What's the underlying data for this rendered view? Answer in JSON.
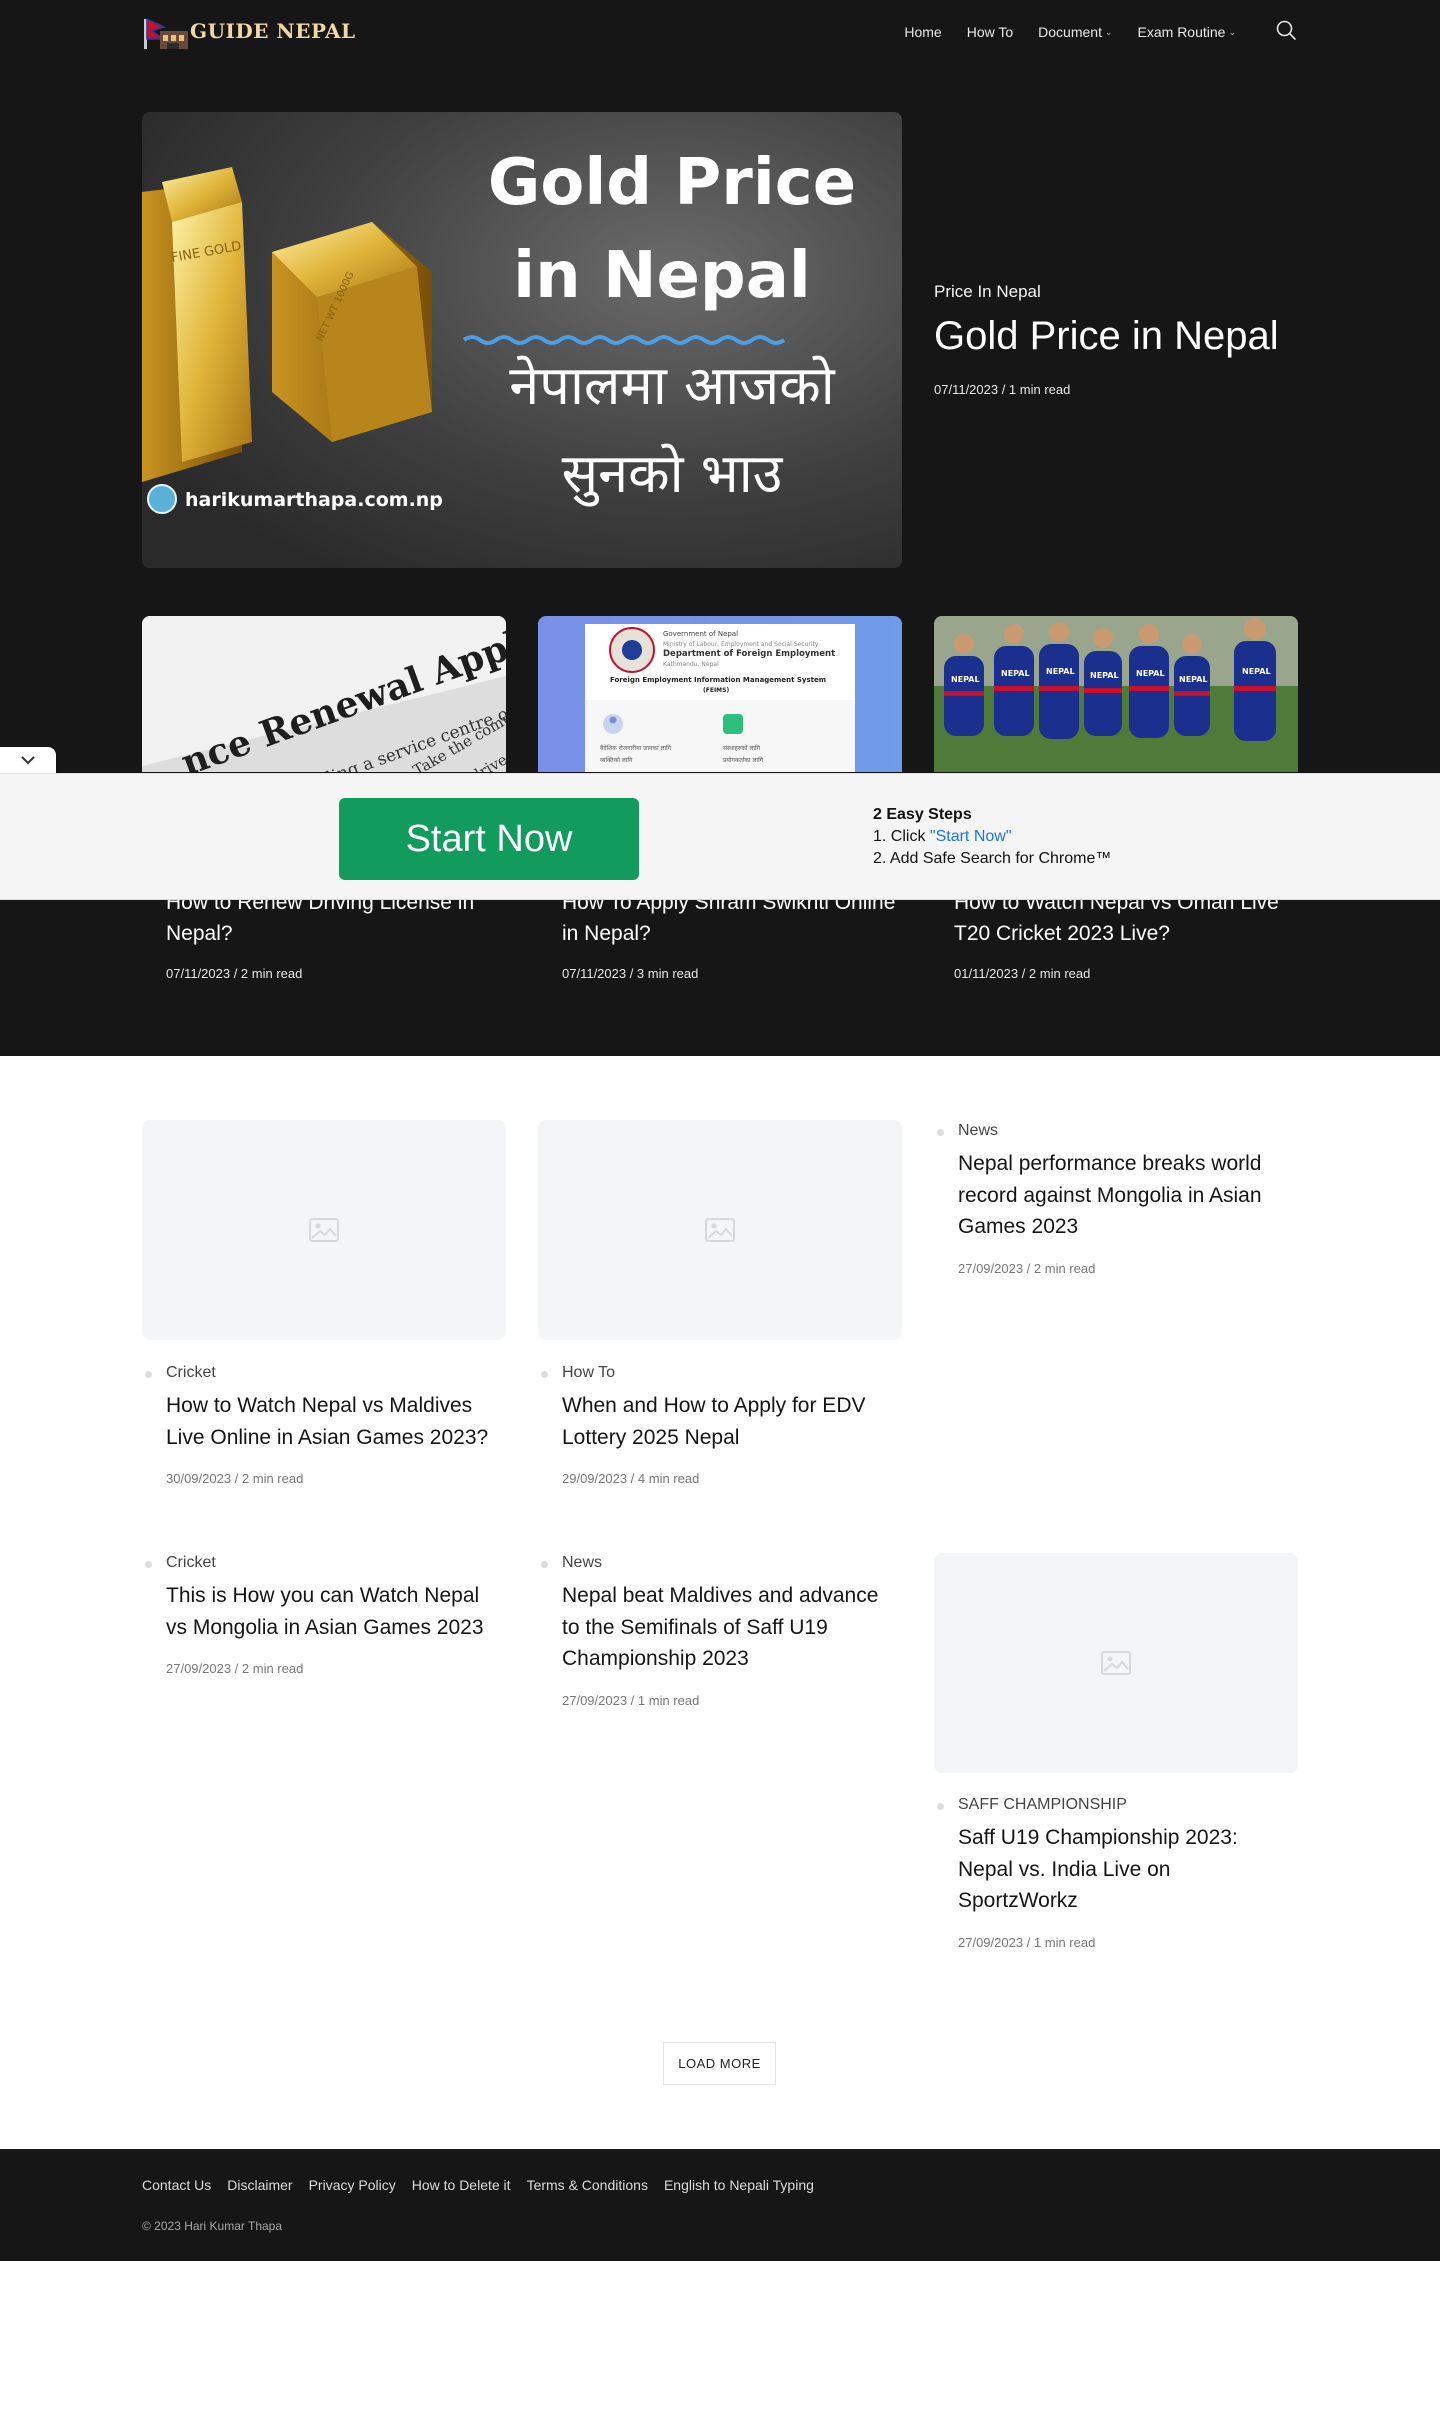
{
  "site": {
    "logo_text": "GUIDE NEPAL"
  },
  "nav": {
    "items": [
      {
        "label": "Home"
      },
      {
        "label": "How To"
      },
      {
        "label": "Document",
        "dropdown": true
      },
      {
        "label": "Exam Routine",
        "dropdown": true
      }
    ],
    "search_icon": "search-icon"
  },
  "hero": {
    "image": {
      "line1": "Gold Price",
      "line2": "in Nepal",
      "devanagari1": "नेपालमा आजको",
      "devanagari2": "सुनको भाउ",
      "site": "harikumarthapa.com.np",
      "bar1_stamp": "FINE GOLD",
      "bar2_stamp": "NET WT 1000G"
    },
    "category": "Price In Nepal",
    "title": "Gold Price in Nepal",
    "meta": "07/11/2023  /  1 min read"
  },
  "dark_cards": [
    {
      "thumb_text_big": "nce Renewal Application",
      "thumb_text_small1": "attending a service centre or re",
      "thumb_text_small2": "Take the complete",
      "thumb_text_small3": "you drive",
      "title": "How to Renew Driving License in Nepal?",
      "meta": "07/11/2023  /  2 min read"
    },
    {
      "thumb_gov": "Government of Nepal",
      "thumb_ministry": "Ministry of Labour, Employment and Social Security",
      "thumb_dept": "Department of Foreign Employment",
      "thumb_place": "Kathmandu, Nepal",
      "thumb_system": "Foreign Employment Information Management System",
      "thumb_feims": "(FEIMS)",
      "thumb_note1": "वैदेशिक रोजगारीमा जानका लागि",
      "thumb_note2": "व्यक्तिको लागि",
      "thumb_note3": "संस्थाहरुको लागि",
      "thumb_note4": "प्रयोगकर्ताका लागि",
      "title": "How To Apply Shram Swikriti Online in Nepal?",
      "meta": "07/11/2023  /  3 min read"
    },
    {
      "thumb_jersey": "NEPAL",
      "title": "How to Watch Nepal vs Oman Live T20 Cricket 2023 Live?",
      "meta": "01/11/2023  /  2 min read"
    }
  ],
  "ad": {
    "button_label": "Start Now",
    "steps_title": "2 Easy Steps",
    "step1_prefix": "1. Click ",
    "step1_link": "\"Start Now\"",
    "step2": "2. Add Safe Search for Chrome™",
    "toggle_icon": "chevron-down-icon"
  },
  "posts": [
    {
      "category": "News",
      "title": "Nepal performance breaks world record against Mongolia in Asian Games 2023",
      "meta": "27/09/2023  /  2 min read"
    },
    {
      "category": "Cricket",
      "title": "How to Watch Nepal vs Maldives Live Online in Asian Games 2023?",
      "meta": "30/09/2023  /  2 min read"
    },
    {
      "category": "How To",
      "title": "When and How to Apply for EDV Lottery 2025 Nepal",
      "meta": "29/09/2023  /  4 min read"
    },
    {
      "category": "Cricket",
      "title": "This is How you can Watch Nepal vs Mongolia in Asian Games 2023",
      "meta": "27/09/2023  /  2 min read"
    },
    {
      "category": "News",
      "title": "Nepal beat Maldives and advance to the Semifinals of Saff U19 Championship 2023",
      "meta": "27/09/2023  /  1 min read"
    },
    {
      "category": "SAFF CHAMPIONSHIP",
      "title": "Saff U19 Championship 2023: Nepal vs. India Live on SportzWorkz",
      "meta": "27/09/2023  /  1 min read"
    }
  ],
  "load_more": "LOAD MORE",
  "footer": {
    "links": [
      "Contact Us",
      "Disclaimer",
      "Privacy Policy",
      "How to Delete it",
      "Terms & Conditions",
      "English to Nepali Typing"
    ],
    "copyright": "© 2023 Hari Kumar Thapa"
  },
  "colors": {
    "dark_bg": "#161617",
    "ad_button": "#119c5e",
    "ad_link": "#1a73e8",
    "placeholder": "#f4f5f7"
  }
}
